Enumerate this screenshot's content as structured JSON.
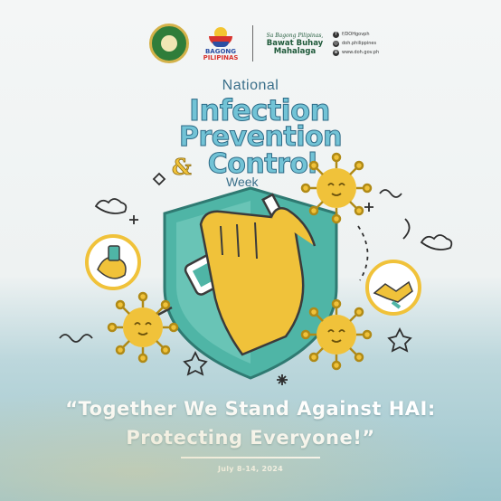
{
  "header": {
    "seal_icon": "department-seal-icon",
    "bagong_pilipinas": {
      "line1": "BAGONG",
      "line2": "PILIPINAS"
    },
    "slogan": {
      "small": "Sa Bagong Pilipinas,",
      "big_line1": "Bawat Buhay",
      "big_line2": "Mahalaga"
    },
    "socials": [
      {
        "icon": "facebook-icon",
        "text": "f/DOHgovph"
      },
      {
        "icon": "instagram-icon",
        "text": "doh.philippines"
      },
      {
        "icon": "globe-icon",
        "text": "www.doh.gov.ph"
      }
    ]
  },
  "title": {
    "national": "National",
    "line1": "Infection",
    "line2": "Prevention",
    "ampersand": "&",
    "line3": "Control",
    "week": "Week"
  },
  "theme": {
    "line1": "“Together We Stand Against HAI:",
    "line2": "Protecting Everyone!”"
  },
  "date": "July 8-14, 2024",
  "colors": {
    "title_fill": "#72c3d6",
    "title_outline": "#2d6a86",
    "virus_yellow": "#f0c23a",
    "shield_teal": "#4fb5a6",
    "shield_outline": "#2f7a72",
    "accent_red": "#d8332e",
    "accent_blue": "#2b4fa3"
  }
}
